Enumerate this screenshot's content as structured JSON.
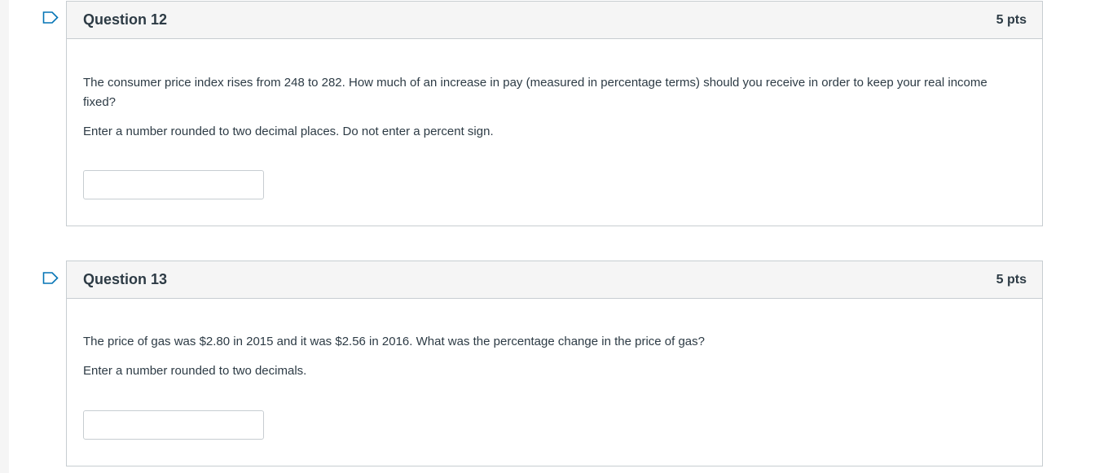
{
  "questions": [
    {
      "title": "Question 12",
      "points": "5 pts",
      "paragraphs": [
        "The consumer price index rises from 248 to 282. How much of an increase in pay (measured in percentage terms) should you receive in order to keep your real income fixed?",
        "Enter a number rounded to two decimal places. Do not enter a percent sign."
      ],
      "answer_value": ""
    },
    {
      "title": "Question 13",
      "points": "5 pts",
      "paragraphs": [
        "The price of gas was $2.80 in 2015 and it was $2.56 in 2016.  What was the percentage change in the price of gas?",
        "Enter a number rounded to two decimals."
      ],
      "answer_value": ""
    }
  ],
  "colors": {
    "flag_stroke": "#0374b5",
    "border": "#c7cdd1",
    "header_bg": "#f5f5f5",
    "text": "#2d3b45"
  }
}
